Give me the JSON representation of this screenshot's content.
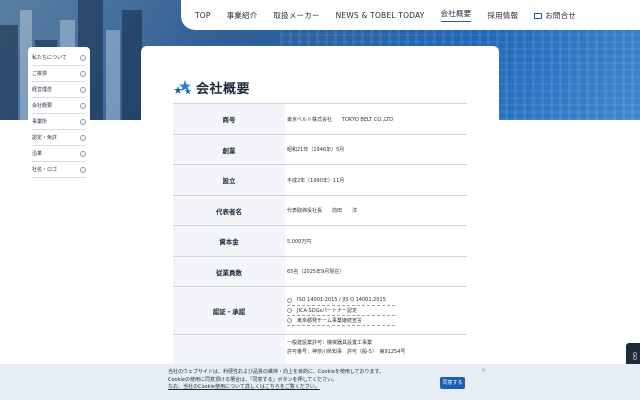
{
  "nav": {
    "items": [
      "TOP",
      "事業紹介",
      "取扱メーカー",
      "NEWS & TOBEL TODAY",
      "会社概要",
      "採用情報"
    ],
    "active_index": 4,
    "contact_label": "お問合せ",
    "contact_icon": "mail-icon"
  },
  "side_menu": {
    "items": [
      "私たちについて",
      "ご挨拶",
      "経営理念",
      "会社概要",
      "事業所",
      "認定・免許",
      "沿革",
      "社名・ロゴ"
    ],
    "icon": "chevron-right-circle-icon"
  },
  "page": {
    "title": "会社概要",
    "title_icon": "stars-icon",
    "accent": "#1a5fb4"
  },
  "info": {
    "rows": [
      {
        "key": "商号",
        "value": "東京ベルト株式会社　　TOKYO BELT CO.,LTD"
      },
      {
        "key": "創業",
        "value": "昭和21年（1946年）5月"
      },
      {
        "key": "設立",
        "value": "平成2年（1990年）11月"
      },
      {
        "key": "代表者名",
        "value": "代表取締役社長　　前田　　淳"
      },
      {
        "key": "資本金",
        "value": "5,000万円"
      },
      {
        "key": "従業員数",
        "value": "65名（2025年9月現在）"
      }
    ],
    "cert_key": "認証・承認",
    "certs": [
      "ISO 14001:2015 / JIS Q 14001:2015",
      "JICA-SDGsパートナー認定",
      "東京都発チーム事業継続宣言"
    ],
    "license_lines": [
      "一般建設業許可：機械器具設置工事業",
      "許可番号：神奈川県知事　許可（般-5）　第91254号"
    ]
  },
  "right_tab": {
    "label": "GO"
  },
  "cookie": {
    "lines": [
      "当社のウェブサイトは、利便性および品質の維持・向上を目的に、Cookieを使用しております。",
      "Cookieの使用に同意頂ける場合は、「同意する」ボタンを押してください。",
      "なお、当社のCookie使用について詳しくはこちらをご覧ください。"
    ],
    "accept_label": "同意する",
    "close_label": "×"
  }
}
